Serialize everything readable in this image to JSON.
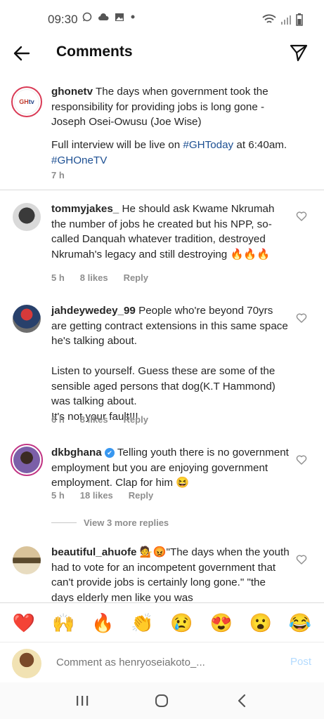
{
  "status": {
    "time": "09:30"
  },
  "header": {
    "title": "Comments"
  },
  "caption": {
    "username": "ghonetv",
    "text_line1": " The days when government took the responsibility for providing jobs is long gone - Joseph Osei-Owusu (Joe Wise)",
    "text_line2": "Full interview will be live on ",
    "hashtag1": "#GHToday",
    "text_line3": " at 6:40am.",
    "hashtag2": "#GHOneTV",
    "avatar_text": "GH one TV",
    "time": "7 h"
  },
  "comments": [
    {
      "username": "tommyjakes_",
      "text": " He should ask Kwame Nkrumah the number of jobs he created but his NPP, so-called Danquah whatever tradition, destroyed Nkrumah's legacy and still destroying 🔥🔥🔥",
      "time": "5 h",
      "likes": "8 likes",
      "reply": "Reply"
    },
    {
      "username": "jahdeywedey_99",
      "text": " People who're beyond 70yrs are getting contract extensions in this same space he's talking about.\n\nListen to yourself. Guess these are some of the sensible aged persons that dog(K.T Hammond) was talking about.\nIt's not your fault!!!",
      "time": "6 h",
      "likes": "8 likes",
      "reply": "Reply"
    },
    {
      "username": "dkbghana",
      "verified": "✔",
      "text": " Telling youth there is no government employment but you are enjoying government employment. Clap for him 😆",
      "time": "5 h",
      "likes": "18 likes",
      "reply": "Reply"
    },
    {
      "username": "beautiful_ahuofe",
      "text": " 💁😡\"The days when the youth had to vote for an incompetent government that can't provide jobs is certainly long gone.\" \"the days  elderly men like you was"
    }
  ],
  "view_more": "View 3 more replies",
  "reactions": [
    "❤️",
    "🙌",
    "🔥",
    "👏",
    "😢",
    "😍",
    "😮",
    "😂"
  ],
  "comment_bar": {
    "placeholder": "Comment as henryoseiakoto_...",
    "post_label": "Post"
  },
  "colors": {
    "link": "#1c4f92",
    "accent": "#d93a55",
    "post_disabled": "#b3dbff"
  }
}
